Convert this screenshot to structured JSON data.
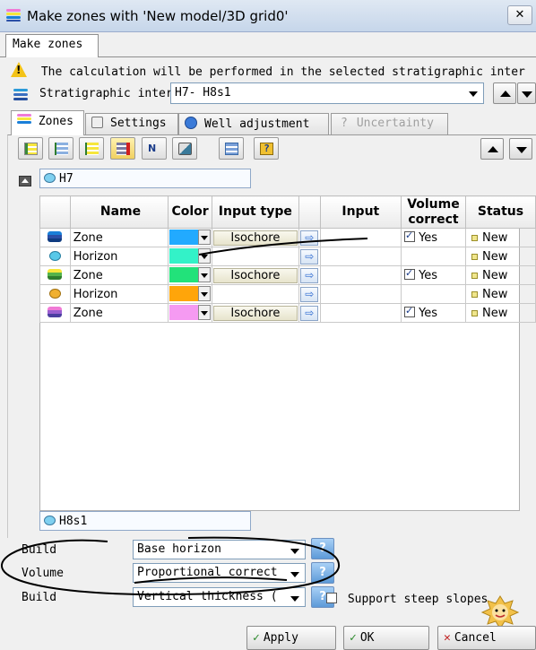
{
  "window": {
    "title": "Make zones with 'New model/3D grid0'",
    "close_label": "✕"
  },
  "outer_tab": {
    "label": "Make zones"
  },
  "warning": {
    "text": "The calculation will be performed in the selected stratigraphic inter"
  },
  "stratigraphic": {
    "label": "Stratigraphic interval:",
    "value": "H7- H8s1"
  },
  "inner_tabs": [
    {
      "label": "Zones",
      "state": "active"
    },
    {
      "label": "Settings",
      "state": "normal"
    },
    {
      "label": "Well adjustment",
      "state": "normal"
    },
    {
      "label": "Uncertainty",
      "state": "disabled"
    }
  ],
  "top_horizon": {
    "label": "H7"
  },
  "bottom_horizon": {
    "label": "H8s1"
  },
  "table": {
    "columns": [
      "",
      "Name",
      "Color",
      "Input type",
      "",
      "Input",
      "Volume correct",
      "Status"
    ],
    "rows": [
      {
        "icon": "zone-layers-icon",
        "name": "Zone",
        "color": "#22aaff",
        "input_type": "Isochore",
        "input": "",
        "volume_correct": "Yes",
        "checked": true,
        "status": "New"
      },
      {
        "icon": "horizon-icon",
        "name": "Horizon",
        "color": "#33f2c8",
        "input_type": "",
        "input": "",
        "volume_correct": "",
        "checked": false,
        "status": "New"
      },
      {
        "icon": "zone-layers-icon",
        "name": "Zone",
        "color": "#22e27a",
        "input_type": "Isochore",
        "input": "",
        "volume_correct": "Yes",
        "checked": true,
        "status": "New"
      },
      {
        "icon": "horizon-icon",
        "name": "Horizon",
        "color": "#ffa50a",
        "input_type": "",
        "input": "",
        "volume_correct": "",
        "checked": false,
        "status": "New"
      },
      {
        "icon": "zone-layers-icon",
        "name": "Zone",
        "color": "#f59af2",
        "input_type": "Isochore",
        "input": "",
        "volume_correct": "Yes",
        "checked": true,
        "status": "New"
      }
    ]
  },
  "build": {
    "row1": {
      "label": "Build",
      "value": "Base horizon"
    },
    "row2": {
      "label": "Volume",
      "value": "Proportional correct"
    },
    "row3": {
      "label": "Build",
      "value": "Vertical thickness (",
      "checkbox_label": "Support steep slopes"
    }
  },
  "buttons": {
    "apply": "Apply",
    "ok": "OK",
    "cancel": "Cancel"
  },
  "colors": {
    "titlebar": "#c6d6ea",
    "warning": "#f3c318",
    "help_blue": "#5d9ad8"
  }
}
